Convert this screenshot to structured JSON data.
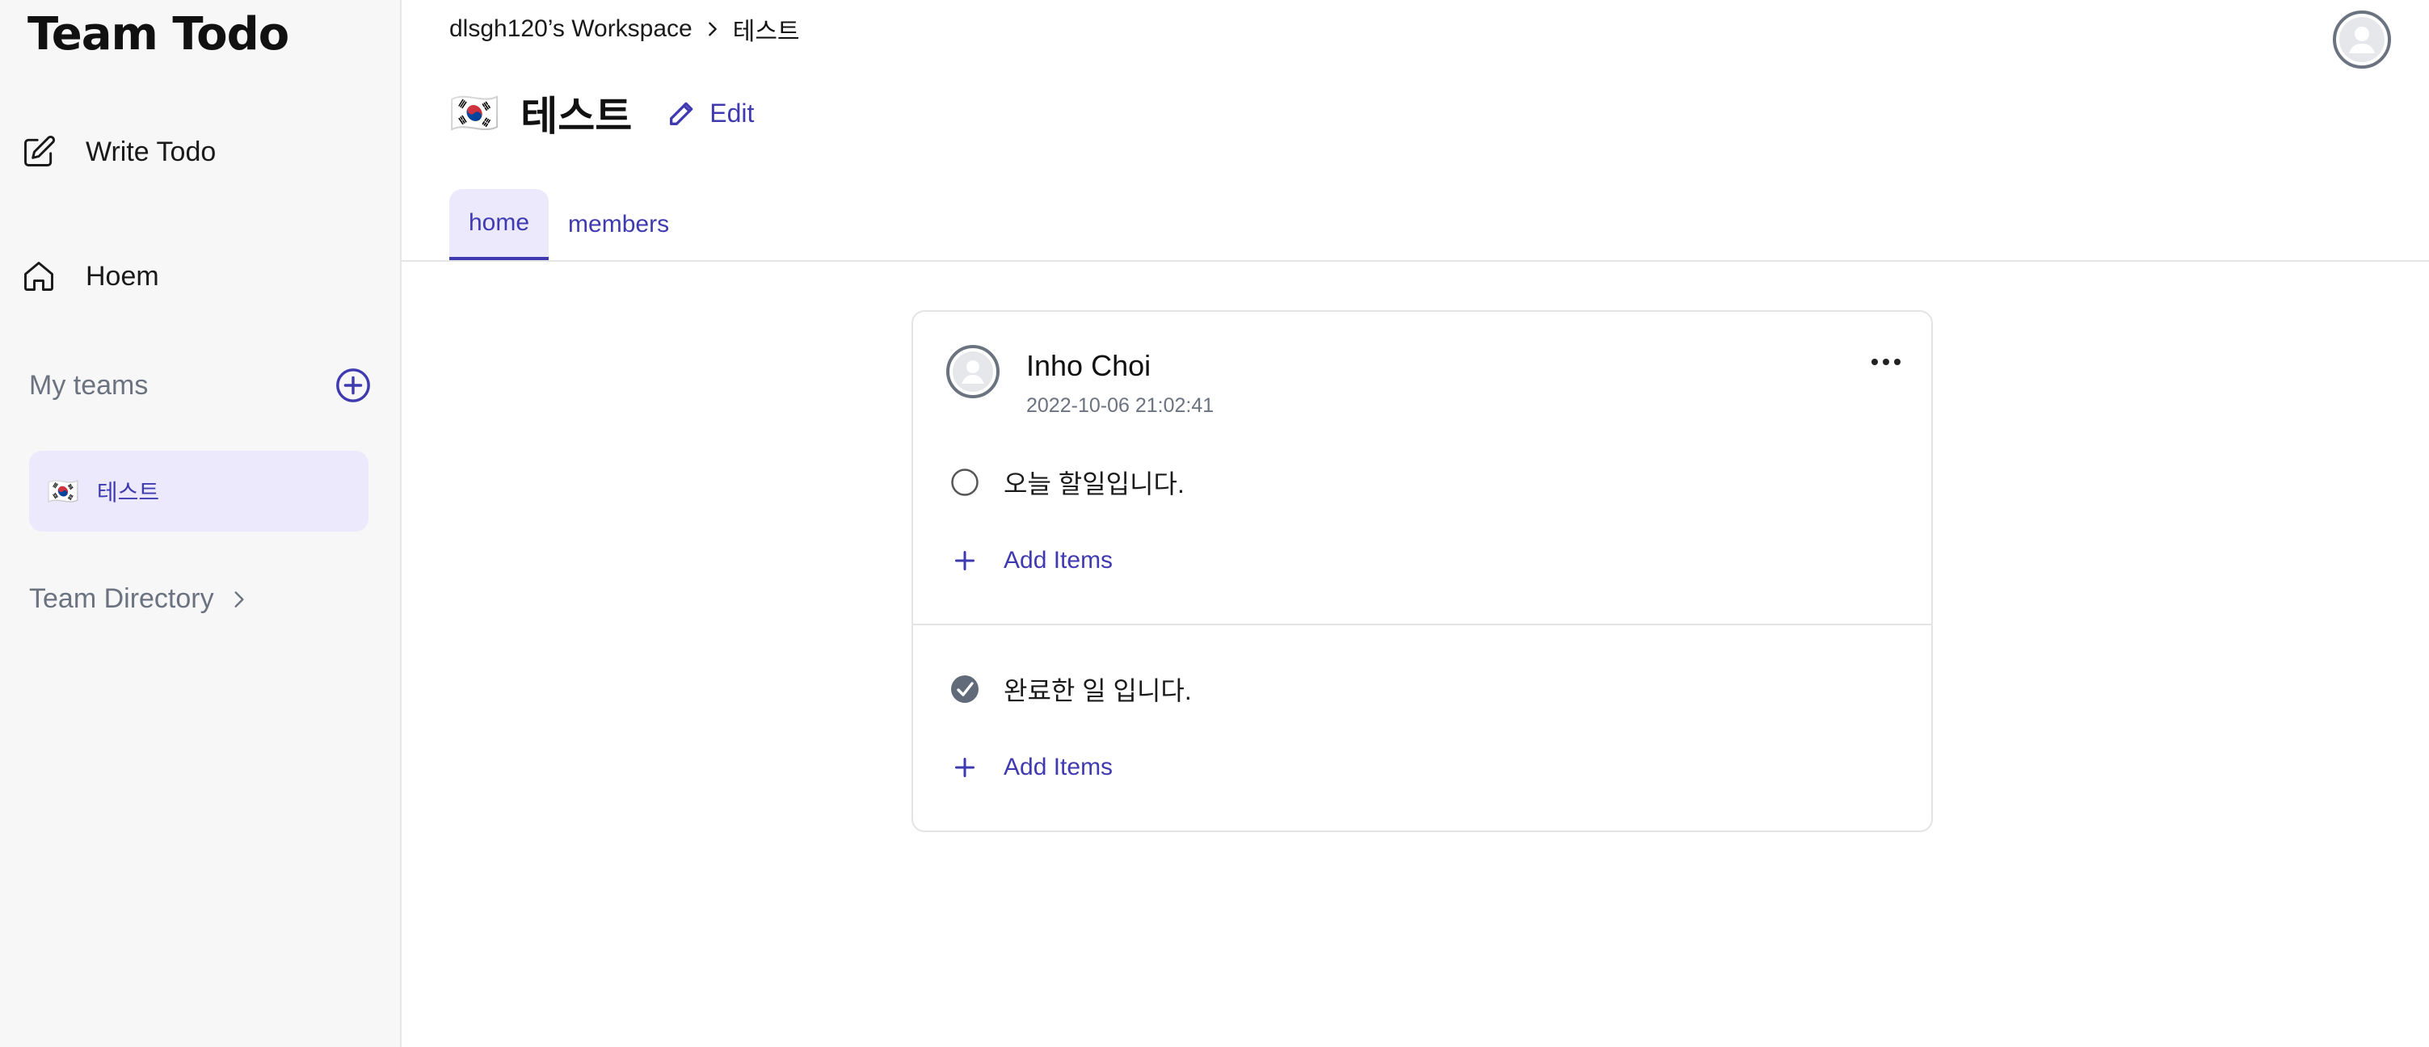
{
  "sidebar": {
    "brand": "Team Todo",
    "nav": [
      {
        "label": "Write Todo",
        "icon": "edit-square-icon"
      },
      {
        "label": "Hoem",
        "icon": "home-icon"
      }
    ],
    "my_teams_label": "My teams",
    "add_team_icon": "plus-circle-icon",
    "teams": [
      {
        "flag": "🇰🇷",
        "name": "테스트"
      }
    ],
    "team_directory_label": "Team Directory"
  },
  "header": {
    "breadcrumb": {
      "workspace": "dlsgh120’s Workspace",
      "current": "테스트"
    },
    "title_flag": "🇰🇷",
    "title": "테스트",
    "edit_label": "Edit"
  },
  "tabs": [
    {
      "label": "home",
      "active": true
    },
    {
      "label": "members",
      "active": false
    }
  ],
  "post": {
    "author": "Inho Choi",
    "timestamp": "2022-10-06 21:02:41",
    "todos": [
      {
        "text": "오늘 할일입니다.",
        "done": false
      },
      {
        "text": "완료한 일 입니다.",
        "done": true
      }
    ],
    "add_items_label": "Add Items"
  },
  "colors": {
    "accent": "#3f3ab0",
    "accent_light": "#ebe9fb",
    "sidebar_bg": "#f7f7f7",
    "muted": "#6b7280"
  }
}
